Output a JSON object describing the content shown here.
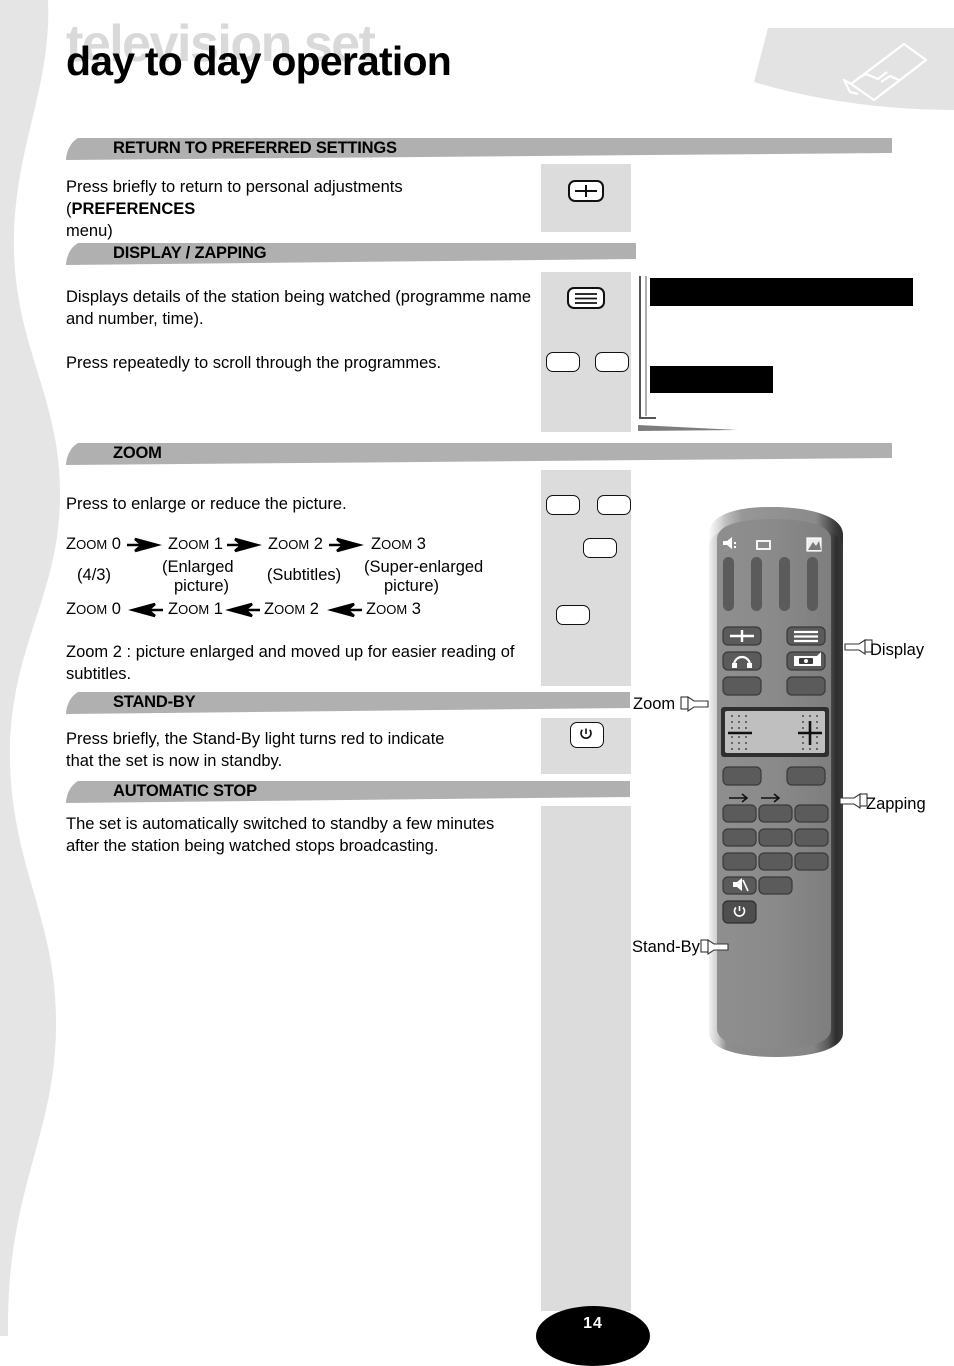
{
  "header": {
    "ghost_title": "television set",
    "title": "day to day operation"
  },
  "sections": [
    {
      "id": "return-to-preferred-settings",
      "title": "RETURN TO PREFERRED SETTINGS",
      "body_pre": "Press briefly to return to personal adjustments (",
      "body_bold": "PREFERENCES",
      "body_post": "",
      "body_line2": "menu)"
    },
    {
      "id": "display-zapping",
      "title": "DISPLAY / ZAPPING",
      "para1": "Displays details of the station being watched (programme name and number, time).",
      "para2": "Press repeatedly to scroll through the programmes."
    },
    {
      "id": "zoom",
      "title": "ZOOM",
      "para1": "Press to enlarge or reduce the picture.",
      "note": "Zoom 2 : picture enlarged and moved up for easier reading of subtitles."
    },
    {
      "id": "stand-by",
      "title": "STAND-BY",
      "para1": "Press briefly, the Stand-By light turns red to indicate",
      "para2": "that the set is now in standby."
    },
    {
      "id": "automatic-stop",
      "title": "AUTOMATIC STOP",
      "para1": "The set is automatically switched to standby a few minutes",
      "para2": "after the station being watched stops broadcasting."
    }
  ],
  "zoom_diagram": {
    "forward": [
      {
        "word": "Z",
        "small": "OOM",
        "num": "0"
      },
      {
        "word": "Z",
        "small": "OOM",
        "num": "1"
      },
      {
        "word": "Z",
        "small": "OOM",
        "num": "2"
      },
      {
        "word": "Z",
        "small": "OOM",
        "num": "3"
      }
    ],
    "backward": [
      {
        "word": "Z",
        "small": "OOM",
        "num": "0"
      },
      {
        "word": "Z",
        "small": "OOM",
        "num": "1"
      },
      {
        "word": "Z",
        "small": "OOM",
        "num": "2"
      },
      {
        "word": "Z",
        "small": "OOM",
        "num": "3"
      }
    ],
    "captions": [
      "(4/3)",
      "(Enlarged\npicture)",
      "(Subtitles)",
      "(Super-enlarged\npicture)"
    ],
    "caption_0": "(4/3)",
    "caption_1_l1": "(Enlarged",
    "caption_1_l2": "picture)",
    "caption_2": "(Subtitles)",
    "caption_3_l1": "(Super-enlarged",
    "caption_3_l2": "picture)"
  },
  "remote": {
    "icons": {
      "volume": "volume-icon",
      "screen": "screen-icon",
      "picture": "picture-icon",
      "contrast": "contrast-key-icon",
      "headphone": "headphone-icon",
      "display": "display-lines-icon",
      "source": "source-icon",
      "mute": "mute-icon",
      "power": "power-icon"
    }
  },
  "callouts": [
    {
      "id": "display",
      "label": "Display"
    },
    {
      "id": "zoom",
      "label": "Zoom"
    },
    {
      "id": "zapping",
      "label": "Zapping"
    },
    {
      "id": "standby",
      "label": "Stand-By"
    }
  ],
  "page": {
    "number": "14"
  }
}
